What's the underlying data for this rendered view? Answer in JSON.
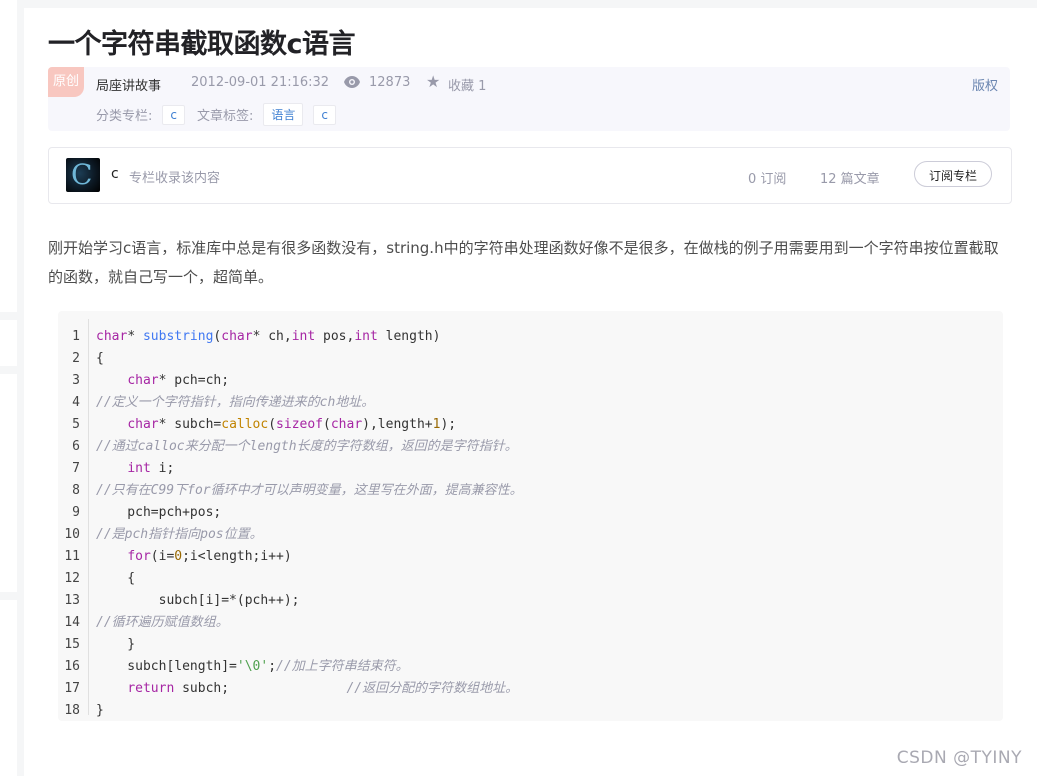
{
  "article": {
    "title": "一个字符串截取函数c语言",
    "badge": "原创",
    "author": "局座讲故事",
    "date": "2012-09-01 21:16:32",
    "views": "12873",
    "favorites": "收藏 1",
    "copyright": "版权",
    "category_label": "分类专栏:",
    "category_tag": "c",
    "tags_label": "文章标签:",
    "tags": [
      "语言",
      "c"
    ]
  },
  "column": {
    "name": "c",
    "description": "专栏收录该内容",
    "subscribers": "0 订阅",
    "articles": "12 篇文章",
    "subscribe_button": "订阅专栏"
  },
  "paragraph": "刚开始学习c语言，标准库中总是有很多函数没有，string.h中的字符串处理函数好像不是很多，在做栈的例子用需要用到一个字符串按位置截取的函数，就自己写一个，超简单。",
  "code": {
    "colors": {
      "keyword": "#a626a4",
      "function": "#4078f2",
      "builtin": "#c18401",
      "number": "#986801",
      "string": "#50a14f",
      "comment": "#999aaa"
    },
    "lines": [
      {
        "n": "1",
        "segments": [
          {
            "t": "char",
            "c": "keyword"
          },
          {
            "t": "* ",
            "c": "plain"
          },
          {
            "t": "substring",
            "c": "function"
          },
          {
            "t": "(",
            "c": "plain"
          },
          {
            "t": "char",
            "c": "keyword"
          },
          {
            "t": "* ch,",
            "c": "plain"
          },
          {
            "t": "int",
            "c": "keyword"
          },
          {
            "t": " pos,",
            "c": "plain"
          },
          {
            "t": "int",
            "c": "keyword"
          },
          {
            "t": " length)",
            "c": "plain"
          }
        ]
      },
      {
        "n": "2",
        "segments": [
          {
            "t": "{",
            "c": "plain"
          }
        ]
      },
      {
        "n": "3",
        "segments": [
          {
            "t": "    ",
            "c": "plain"
          },
          {
            "t": "char",
            "c": "keyword"
          },
          {
            "t": "* pch=ch;",
            "c": "plain"
          }
        ]
      },
      {
        "n": "4",
        "segments": [
          {
            "t": "//定义一个字符指针，指向传递进来的ch地址。",
            "c": "comment"
          }
        ]
      },
      {
        "n": "5",
        "segments": [
          {
            "t": "    ",
            "c": "plain"
          },
          {
            "t": "char",
            "c": "keyword"
          },
          {
            "t": "* subch=",
            "c": "plain"
          },
          {
            "t": "calloc",
            "c": "builtin"
          },
          {
            "t": "(",
            "c": "plain"
          },
          {
            "t": "sizeof",
            "c": "keyword"
          },
          {
            "t": "(",
            "c": "plain"
          },
          {
            "t": "char",
            "c": "keyword"
          },
          {
            "t": "),length+",
            "c": "plain"
          },
          {
            "t": "1",
            "c": "number"
          },
          {
            "t": ");",
            "c": "plain"
          }
        ]
      },
      {
        "n": "6",
        "segments": [
          {
            "t": "//通过calloc来分配一个length长度的字符数组，返回的是字符指针。",
            "c": "comment"
          }
        ]
      },
      {
        "n": "7",
        "segments": [
          {
            "t": "    ",
            "c": "plain"
          },
          {
            "t": "int",
            "c": "keyword"
          },
          {
            "t": " i;",
            "c": "plain"
          }
        ]
      },
      {
        "n": "8",
        "segments": [
          {
            "t": "//只有在C99下for循环中才可以声明变量，这里写在外面，提高兼容性。",
            "c": "comment"
          }
        ]
      },
      {
        "n": "9",
        "segments": [
          {
            "t": "    pch=pch+pos;",
            "c": "plain"
          }
        ]
      },
      {
        "n": "10",
        "segments": [
          {
            "t": "//是pch指针指向pos位置。",
            "c": "comment"
          }
        ]
      },
      {
        "n": "11",
        "segments": [
          {
            "t": "    ",
            "c": "plain"
          },
          {
            "t": "for",
            "c": "keyword"
          },
          {
            "t": "(i=",
            "c": "plain"
          },
          {
            "t": "0",
            "c": "number"
          },
          {
            "t": ";i<length;i++)",
            "c": "plain"
          }
        ]
      },
      {
        "n": "12",
        "segments": [
          {
            "t": "    {",
            "c": "plain"
          }
        ]
      },
      {
        "n": "13",
        "segments": [
          {
            "t": "        subch[i]=*(pch++);",
            "c": "plain"
          }
        ]
      },
      {
        "n": "14",
        "segments": [
          {
            "t": "//循环遍历赋值数组。",
            "c": "comment"
          }
        ]
      },
      {
        "n": "15",
        "segments": [
          {
            "t": "    }",
            "c": "plain"
          }
        ]
      },
      {
        "n": "16",
        "segments": [
          {
            "t": "    subch[length]=",
            "c": "plain"
          },
          {
            "t": "'\\0'",
            "c": "string"
          },
          {
            "t": ";",
            "c": "plain"
          },
          {
            "t": "//加上字符串结束符。",
            "c": "comment"
          }
        ]
      },
      {
        "n": "17",
        "segments": [
          {
            "t": "    ",
            "c": "plain"
          },
          {
            "t": "return",
            "c": "keyword"
          },
          {
            "t": " subch;               ",
            "c": "plain"
          },
          {
            "t": "//返回分配的字符数组地址。",
            "c": "comment"
          }
        ]
      },
      {
        "n": "18",
        "segments": [
          {
            "t": "}",
            "c": "plain"
          }
        ]
      }
    ]
  },
  "watermark": "CSDN @TYINY"
}
